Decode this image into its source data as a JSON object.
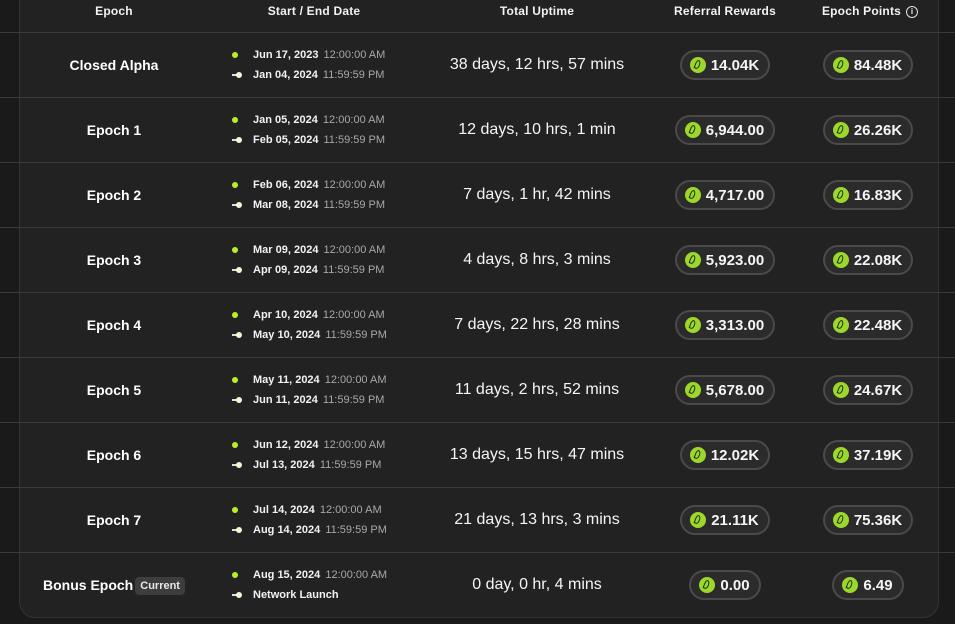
{
  "headers": {
    "epoch": "Epoch",
    "dates": "Start / End Date",
    "uptime": "Total Uptime",
    "referral": "Referral Rewards",
    "points": "Epoch Points",
    "points_info_icon": "info-icon"
  },
  "coin_icon": "leaf-coin-icon",
  "accent_color": "#9bd82b",
  "rows": [
    {
      "name": "Closed Alpha",
      "badge": "",
      "start_date": "Jun 17, 2023",
      "start_time": "12:00:00 AM",
      "end_date": "Jan 04, 2024",
      "end_time": "11:59:59 PM",
      "uptime": "38 days, 12 hrs, 57 mins",
      "referral": "14.04K",
      "points": "84.48K"
    },
    {
      "name": "Epoch 1",
      "badge": "",
      "start_date": "Jan 05, 2024",
      "start_time": "12:00:00 AM",
      "end_date": "Feb 05, 2024",
      "end_time": "11:59:59 PM",
      "uptime": "12 days, 10 hrs, 1 min",
      "referral": "6,944.00",
      "points": "26.26K"
    },
    {
      "name": "Epoch 2",
      "badge": "",
      "start_date": "Feb 06, 2024",
      "start_time": "12:00:00 AM",
      "end_date": "Mar 08, 2024",
      "end_time": "11:59:59 PM",
      "uptime": "7 days, 1 hr, 42 mins",
      "referral": "4,717.00",
      "points": "16.83K"
    },
    {
      "name": "Epoch 3",
      "badge": "",
      "start_date": "Mar 09, 2024",
      "start_time": "12:00:00 AM",
      "end_date": "Apr 09, 2024",
      "end_time": "11:59:59 PM",
      "uptime": "4 days, 8 hrs, 3 mins",
      "referral": "5,923.00",
      "points": "22.08K"
    },
    {
      "name": "Epoch 4",
      "badge": "",
      "start_date": "Apr 10, 2024",
      "start_time": "12:00:00 AM",
      "end_date": "May 10, 2024",
      "end_time": "11:59:59 PM",
      "uptime": "7 days, 22 hrs, 28 mins",
      "referral": "3,313.00",
      "points": "22.48K"
    },
    {
      "name": "Epoch 5",
      "badge": "",
      "start_date": "May 11, 2024",
      "start_time": "12:00:00 AM",
      "end_date": "Jun 11, 2024",
      "end_time": "11:59:59 PM",
      "uptime": "11 days, 2 hrs, 52 mins",
      "referral": "5,678.00",
      "points": "24.67K"
    },
    {
      "name": "Epoch 6",
      "badge": "",
      "start_date": "Jun 12, 2024",
      "start_time": "12:00:00 AM",
      "end_date": "Jul 13, 2024",
      "end_time": "11:59:59 PM",
      "uptime": "13 days, 15 hrs, 47 mins",
      "referral": "12.02K",
      "points": "37.19K"
    },
    {
      "name": "Epoch 7",
      "badge": "",
      "start_date": "Jul 14, 2024",
      "start_time": "12:00:00 AM",
      "end_date": "Aug 14, 2024",
      "end_time": "11:59:59 PM",
      "uptime": "21 days, 13 hrs, 3 mins",
      "referral": "21.11K",
      "points": "75.36K"
    },
    {
      "name": "Bonus Epoch",
      "badge": "Current",
      "start_date": "Aug 15, 2024",
      "start_time": "12:00:00 AM",
      "end_date": "Network Launch",
      "end_time": "",
      "uptime": "0 day, 0 hr, 4 mins",
      "referral": "0.00",
      "points": "6.49"
    }
  ]
}
